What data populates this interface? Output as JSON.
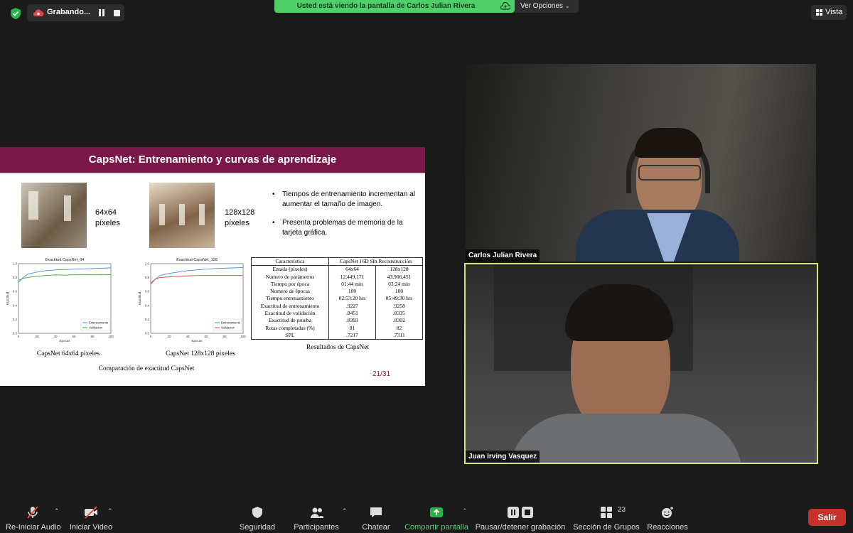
{
  "topbar": {
    "recording_label": "Grabando...",
    "share_banner": "Usted está viendo la pantalla de Carlos Julian Rivera",
    "view_options": "Ver Opciones",
    "view_button": "Vista"
  },
  "slide": {
    "title": "CapsNet: Entrenamiento y curvas de aprendizaje",
    "label_64_line1": "64x64",
    "label_64_line2": "píxeles",
    "label_128_line1": "128x128",
    "label_128_line2": "píxeles",
    "bullets": [
      "Tiempos de entrenamiento incrementan al aumentar el tamaño de imagen.",
      "Presenta problemas de memoria de la tarjeta gráfica."
    ],
    "caption_64": "CapsNet 64x64 píxeles",
    "caption_128": "CapsNet 128x128 píxeles",
    "caption_comparison": "Comparación de exactitud CapsNet",
    "caption_results": "Resultados de CapsNet",
    "page_number": "21/31"
  },
  "chart_data": [
    {
      "type": "line",
      "title": "Exactitud CapsNet_64",
      "xlabel": "Epocas",
      "ylabel": "Exactitud",
      "xlim": [
        0,
        100
      ],
      "ylim": [
        0.0,
        1.0
      ],
      "xticks": [
        "0",
        "20",
        "40",
        "60",
        "80",
        "100"
      ],
      "yticks": [
        "0.0",
        "0.2",
        "0.4",
        "0.6",
        "0.8",
        "1.0"
      ],
      "legend": "bottom-right",
      "series": [
        {
          "name": "Entrenamiento",
          "color": "#4a90d9",
          "x": [
            0,
            5,
            10,
            20,
            30,
            40,
            50,
            60,
            70,
            80,
            90,
            100
          ],
          "y": [
            0.73,
            0.8,
            0.85,
            0.88,
            0.9,
            0.91,
            0.915,
            0.92,
            0.925,
            0.93,
            0.935,
            0.94
          ]
        },
        {
          "name": "Validacion",
          "color": "#3aa535",
          "x": [
            0,
            5,
            10,
            20,
            30,
            40,
            50,
            60,
            70,
            80,
            90,
            100
          ],
          "y": [
            0.76,
            0.79,
            0.8,
            0.82,
            0.83,
            0.84,
            0.835,
            0.84,
            0.845,
            0.84,
            0.845,
            0.84
          ]
        }
      ]
    },
    {
      "type": "line",
      "title": "Exactitud CapsNet_128",
      "xlabel": "Epocas",
      "ylabel": "Exactitud",
      "xlim": [
        0,
        100
      ],
      "ylim": [
        0.0,
        1.0
      ],
      "xticks": [
        "0",
        "20",
        "40",
        "60",
        "80",
        "100"
      ],
      "yticks": [
        "0.0",
        "0.2",
        "0.4",
        "0.6",
        "0.8",
        "1.0"
      ],
      "legend": "bottom-right",
      "series": [
        {
          "name": "Entrenamiento",
          "color": "#4a90d9",
          "x": [
            0,
            5,
            10,
            20,
            30,
            40,
            50,
            60,
            70,
            80,
            90,
            100
          ],
          "y": [
            0.7,
            0.78,
            0.83,
            0.86,
            0.88,
            0.9,
            0.91,
            0.92,
            0.93,
            0.935,
            0.94,
            0.945
          ]
        },
        {
          "name": "Validacion",
          "color": "#e0453a",
          "x": [
            0,
            5,
            10,
            20,
            30,
            40,
            50,
            60,
            70,
            80,
            90,
            100
          ],
          "y": [
            0.72,
            0.78,
            0.8,
            0.81,
            0.82,
            0.825,
            0.83,
            0.83,
            0.83,
            0.83,
            0.83,
            0.83
          ]
        }
      ]
    }
  ],
  "results_table": {
    "headers": [
      "Característica",
      "CapsNet 16D Sin Reconstrucción",
      ""
    ],
    "rows": [
      [
        "Entada (píxeles)",
        "64x64",
        "128x128"
      ],
      [
        "Numero de parámetros",
        "12,449,171",
        "43,906,451"
      ],
      [
        "Tiempo por época",
        "01:44 min",
        "03:24 min"
      ],
      [
        "Numero de épocas",
        "100",
        "100"
      ],
      [
        "Tiempo entrenamiento",
        "02:53:20 hrs",
        "05:49:30 hrs"
      ],
      [
        "Exactitud de entrenamiento",
        ".9227",
        ".9258"
      ],
      [
        "Exactitud de validación",
        ".8451",
        ".8335"
      ],
      [
        "Exactitud de prueba",
        ".8393",
        ".8302"
      ],
      [
        "Rutas completadas (%)",
        "81",
        "82"
      ],
      [
        "SPL",
        ".7217",
        ".7311"
      ]
    ]
  },
  "participants": {
    "tile1_name": "Carlos Julian Rivera",
    "tile2_name": "Juan Irving Vasquez"
  },
  "dock": {
    "audio": "Re-Iniciar Audio",
    "video": "Iniciar Video",
    "security": "Seguridad",
    "participants": "Participantes",
    "participants_count": "23",
    "chat": "Chatear",
    "share": "Compartir pantalla",
    "record": "Pausar/detener grabación",
    "breakout": "Sección de Grupos",
    "reactions": "Reacciones",
    "leave": "Salir"
  },
  "colors": {
    "slide_header": "#7a1848",
    "share_banner": "#4fcf68",
    "leave": "#c6312a",
    "share_icon": "#27b24a",
    "active_speaker_border": "#d9e27a"
  }
}
